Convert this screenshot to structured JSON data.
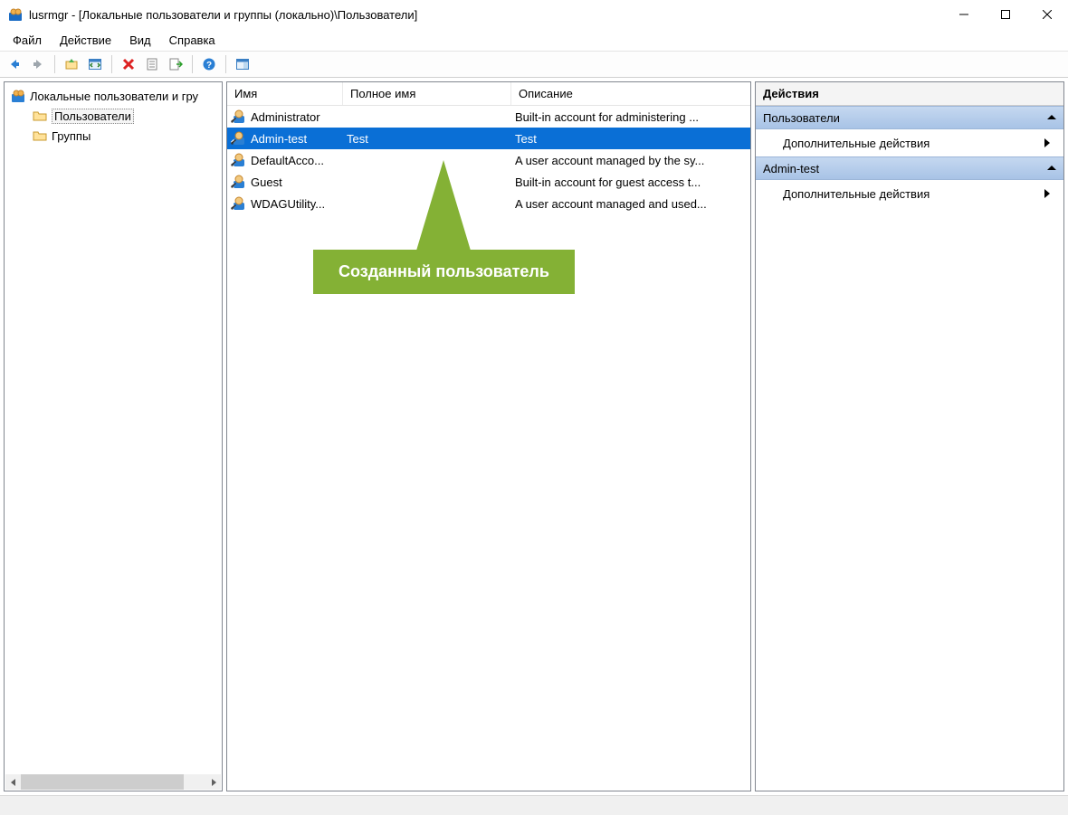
{
  "window": {
    "title": "lusrmgr - [Локальные пользователи и группы (локально)\\Пользователи]"
  },
  "menu": {
    "file": "Файл",
    "action": "Действие",
    "view": "Вид",
    "help": "Справка"
  },
  "tree": {
    "root": "Локальные пользователи и гру",
    "users": "Пользователи",
    "groups": "Группы"
  },
  "columns": {
    "name": "Имя",
    "fullname": "Полное имя",
    "desc": "Описание"
  },
  "users": [
    {
      "name": "Administrator",
      "fullname": "",
      "desc": "Built-in account for administering ...",
      "selected": false,
      "disabled": true
    },
    {
      "name": "Admin-test",
      "fullname": "Test",
      "desc": "Test",
      "selected": true,
      "disabled": false
    },
    {
      "name": "DefaultAcco...",
      "fullname": "",
      "desc": "A user account managed by the sy...",
      "selected": false,
      "disabled": true
    },
    {
      "name": "Guest",
      "fullname": "",
      "desc": "Built-in account for guest access t...",
      "selected": false,
      "disabled": true
    },
    {
      "name": "WDAGUtility...",
      "fullname": "",
      "desc": "A user account managed and used...",
      "selected": false,
      "disabled": true
    }
  ],
  "actions": {
    "title": "Действия",
    "section1": "Пользователи",
    "link1": "Дополнительные действия",
    "section2": "Admin-test",
    "link2": "Дополнительные действия"
  },
  "callout": {
    "text": "Созданный пользователь"
  }
}
